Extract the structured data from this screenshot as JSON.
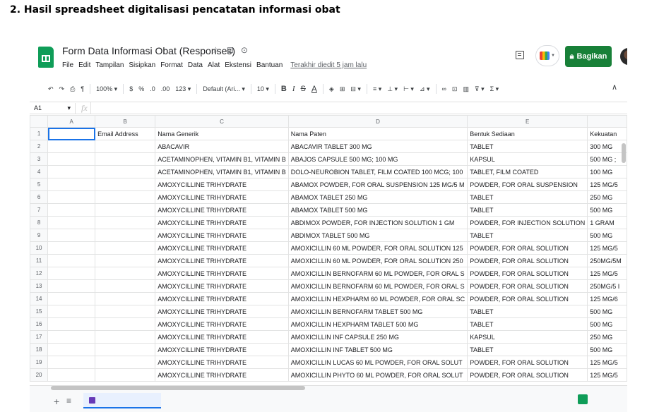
{
  "heading": "2. Hasil spreadsheet digitalisasi pencatatan informasi obat",
  "app": {
    "title": "Form Data Informasi Obat (Responses)",
    "menu": [
      "File",
      "Edit",
      "Tampilan",
      "Sisipkan",
      "Format",
      "Data",
      "Alat",
      "Ekstensi",
      "Bantuan"
    ],
    "last_edit": "Terakhir diedit 5 jam lalu",
    "share_label": "Bagikan",
    "brand_color": "#0f9d58",
    "share_color": "#188038"
  },
  "toolbar": {
    "zoom": "100%",
    "currency": "$",
    "percent": "%",
    "dec_decrease": ".0",
    "dec_increase": ".00",
    "number_format": "123",
    "font": "Default (Ari...",
    "font_size": "10",
    "bold": "B",
    "italic": "I",
    "strike": "S",
    "text_color": "A"
  },
  "formula_bar": {
    "cell_ref": "A1",
    "fx": "fx"
  },
  "grid": {
    "columns": [
      "A",
      "B",
      "C",
      "D",
      "E",
      ""
    ],
    "header_row": [
      "",
      "Email Address",
      "Nama Generik",
      "Nama Paten",
      "Bentuk Sediaan",
      "Kekuatan"
    ],
    "rows": [
      [
        "2",
        "",
        "",
        "ABACAVIR",
        "ABACAVIR TABLET 300 MG",
        "TABLET",
        "300 MG"
      ],
      [
        "3",
        "",
        "",
        "ACETAMINOPHEN, VITAMIN B1, VITAMIN B",
        "ABAJOS CAPSULE 500 MG; 100 MG",
        "KAPSUL",
        "500 MG ;"
      ],
      [
        "4",
        "",
        "",
        "ACETAMINOPHEN, VITAMIN B1, VITAMIN B",
        "DOLO-NEUROBION TABLET, FILM COATED 100 MCG; 100",
        "TABLET, FILM COATED",
        "100 MG"
      ],
      [
        "5",
        "",
        "",
        "AMOXYCILLINE TRIHYDRATE",
        "ABAMOX POWDER, FOR ORAL SUSPENSION 125 MG/5 M",
        "POWDER, FOR ORAL SUSPENSION",
        "125 MG/5"
      ],
      [
        "6",
        "",
        "",
        "AMOXYCILLINE TRIHYDRATE",
        "ABAMOX TABLET 250 MG",
        "TABLET",
        "250 MG"
      ],
      [
        "7",
        "",
        "",
        "AMOXYCILLINE TRIHYDRATE",
        "ABAMOX TABLET 500 MG",
        "TABLET",
        "500 MG"
      ],
      [
        "8",
        "",
        "",
        "AMOXYCILLINE TRIHYDRATE",
        "ABDIMOX POWDER, FOR INJECTION SOLUTION 1 GM",
        "POWDER, FOR INJECTION SOLUTION",
        "1 GRAM"
      ],
      [
        "9",
        "",
        "",
        "AMOXYCILLINE TRIHYDRATE",
        "ABDIMOX TABLET 500 MG",
        "TABLET",
        "500 MG"
      ],
      [
        "10",
        "",
        "",
        "AMOXYCILLINE TRIHYDRATE",
        "AMOXICILLIN 60 ML POWDER, FOR ORAL SOLUTION 125",
        "POWDER, FOR ORAL SOLUTION",
        "125 MG/5"
      ],
      [
        "11",
        "",
        "",
        "AMOXYCILLINE TRIHYDRATE",
        "AMOXICILLIN 60 ML POWDER, FOR ORAL SOLUTION 250",
        "POWDER, FOR ORAL SOLUTION",
        "250MG/5M"
      ],
      [
        "12",
        "",
        "",
        "AMOXYCILLINE TRIHYDRATE",
        "AMOXICILLIN BERNOFARM 60 ML POWDER, FOR ORAL S",
        "POWDER, FOR ORAL SOLUTION",
        "125 MG/5"
      ],
      [
        "13",
        "",
        "",
        "AMOXYCILLINE TRIHYDRATE",
        "AMOXICILLIN BERNOFARM 60 ML POWDER, FOR ORAL S",
        "POWDER, FOR ORAL SOLUTION",
        "250MG/5 I"
      ],
      [
        "14",
        "",
        "",
        "AMOXYCILLINE TRIHYDRATE",
        "AMOXICILLIN HEXPHARM 60 ML POWDER, FOR ORAL SC",
        "POWDER, FOR ORAL SOLUTION",
        "125 MG/6"
      ],
      [
        "15",
        "",
        "",
        "AMOXYCILLINE TRIHYDRATE",
        "AMOXICILLIN BERNOFARM TABLET 500 MG",
        "TABLET",
        "500 MG"
      ],
      [
        "16",
        "",
        "",
        "AMOXYCILLINE TRIHYDRATE",
        "AMOXICILLIN  HEXPHARM TABLET 500 MG",
        "TABLET",
        "500 MG"
      ],
      [
        "17",
        "",
        "",
        "AMOXYCILLINE TRIHYDRATE",
        "AMOXICILLIN INF CAPSULE 250 MG",
        "KAPSUL",
        "250 MG"
      ],
      [
        "18",
        "",
        "",
        "AMOXYCILLINE TRIHYDRATE",
        "AMOXICILLIN  INF TABLET 500 MG",
        "TABLET",
        "500 MG"
      ],
      [
        "19",
        "",
        "",
        "AMOXYCILLINE TRIHYDRATE",
        "AMOXICILLIN LUCAS 60 ML POWDER, FOR ORAL SOLUT",
        "POWDER, FOR  ORAL  SOLUTION",
        "125 MG/5"
      ],
      [
        "20",
        "",
        "",
        "AMOXYCILLINE TRIHYDRATE",
        "AMOXICILLIN PHYTO 60 ML POWDER, FOR ORAL SOLUT",
        "POWDER, FOR ORAL SOLUTION",
        "125 MG/5"
      ]
    ]
  },
  "icons": [
    "sheets-logo-icon",
    "star-icon",
    "move-icon",
    "cloud-status-icon",
    "comment-icon",
    "meet-icon",
    "lock-icon",
    "undo-icon",
    "redo-icon",
    "print-icon",
    "paint-format-icon",
    "fill-color-icon",
    "borders-icon",
    "merge-icon",
    "align-icon",
    "valign-icon",
    "wrap-icon",
    "rotate-icon",
    "link-icon",
    "insert-comment-icon",
    "insert-chart-icon",
    "filter-icon",
    "functions-icon",
    "collapse-icon",
    "add-sheet-icon",
    "all-sheets-icon",
    "explore-icon"
  ]
}
